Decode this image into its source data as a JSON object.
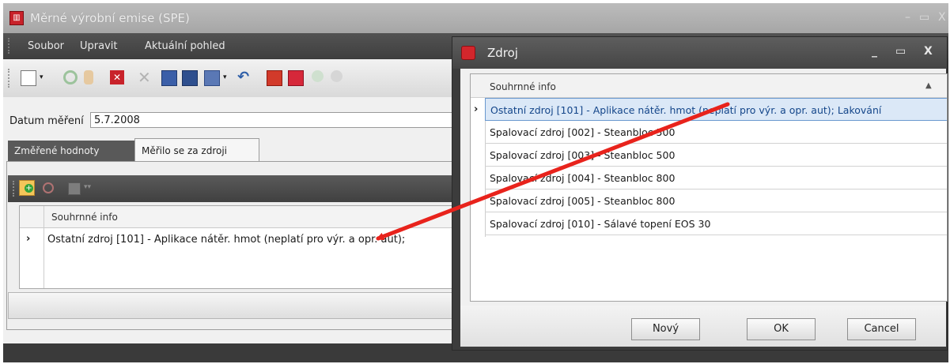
{
  "main_window": {
    "title": "Měrné výrobní emise (SPE)",
    "menu": [
      "Soubor",
      "Upravit",
      "Aktuální pohled"
    ],
    "date_label": "Datum měření",
    "date_value": "5.7.2008",
    "tabs": [
      "Změřené hodnoty",
      "Měřilo se za zdroji"
    ],
    "grid": {
      "column_header": "Souhrnné info",
      "rows": [
        "Ostatní zdroj [101] - Aplikace nátěr. hmot (neplatí pro výr. a opr. aut);"
      ]
    }
  },
  "dialog": {
    "title": "Zdroj",
    "column_header": "Souhrnné info",
    "rows": [
      "Ostatní zdroj [101] - Aplikace nátěr. hmot (neplatí pro výr. a opr. aut); Lakování",
      "Spalovací zdroj [002] - Steanbloc 500",
      "Spalovací zdroj [003] - Steanbloc 500",
      "Spalovací zdroj [004] - Steanbloc 800",
      "Spalovací zdroj [005] - Steanbloc 800",
      "Spalovací zdroj [010] - Sálavé topení EOS 30"
    ],
    "buttons": {
      "new": "Nový",
      "ok": "OK",
      "cancel": "Cancel"
    },
    "window_controls": [
      "_",
      "▭",
      "X"
    ]
  },
  "icons": {
    "row_indicator": "›",
    "sort": "▲",
    "window_controls_faint": [
      "–",
      "▭",
      "X"
    ]
  },
  "colors": {
    "annotation_arrow": "#e8231c",
    "selection": "#dbe8f7"
  }
}
